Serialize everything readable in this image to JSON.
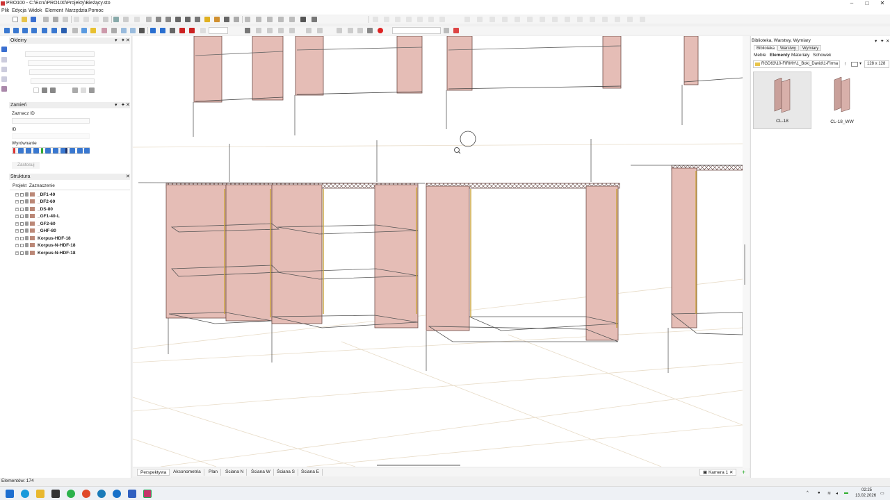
{
  "window": {
    "title": "PRO100 - C:\\Ecru\\PRO100\\Projekty\\Bieżący.sto",
    "minimize": "–",
    "maximize": "□",
    "close": "✕"
  },
  "menu": [
    "Plik",
    "Edycja",
    "Widok",
    "Element",
    "Narzędzia",
    "Pomoc"
  ],
  "left": {
    "okleiny": {
      "title": "Okleiny"
    },
    "zamien": {
      "title": "Zamień",
      "select_id_label": "Zaznacz ID",
      "id_label": "ID",
      "align_label": "Wyrównanie",
      "apply_button": "Zastosuj"
    },
    "struktura": {
      "title": "Struktura",
      "tabs": [
        "Projekt",
        "Zaznaczenie"
      ],
      "items": [
        "_DF1-40",
        "_DF2-60",
        "_DS-80",
        "_GF1-40-L",
        "_GF2-60",
        "_GHF-80",
        "Korpus-HDF-18",
        "Korpus-N-HDF-18",
        "Korpus-N-HDF-18"
      ]
    }
  },
  "viewport": {
    "tabs": [
      "Perspektywa",
      "Aksonometria",
      "Plan",
      "Ściana N",
      "Ściana W",
      "Ściana S",
      "Ściana E"
    ],
    "active_tab": "Perspektywa",
    "camera": "Kamera 1",
    "add_tab": "+"
  },
  "right": {
    "title": "Biblioteka, Warstwy, Wymiary",
    "tabs": [
      "Biblioteka",
      "Warstwy",
      "Wymiary"
    ],
    "subtabs": [
      "Meble",
      "Elementy",
      "Materiały",
      "Schowek"
    ],
    "path": "RGD63\\10-FIRMY\\1_Boki_David\\1-Firma",
    "thumb_size": "128 x 128",
    "items": [
      {
        "name": "CL-18"
      },
      {
        "name": "CL-18_WW"
      }
    ]
  },
  "status": {
    "elements": "Elementów: 174"
  },
  "taskbar": {
    "time": "02:25",
    "date": "13.02.2026"
  },
  "colors": {
    "panel_fill": "#e5bdb6",
    "panel_stroke": "#7a5550",
    "accent": "#1e5fbf"
  }
}
